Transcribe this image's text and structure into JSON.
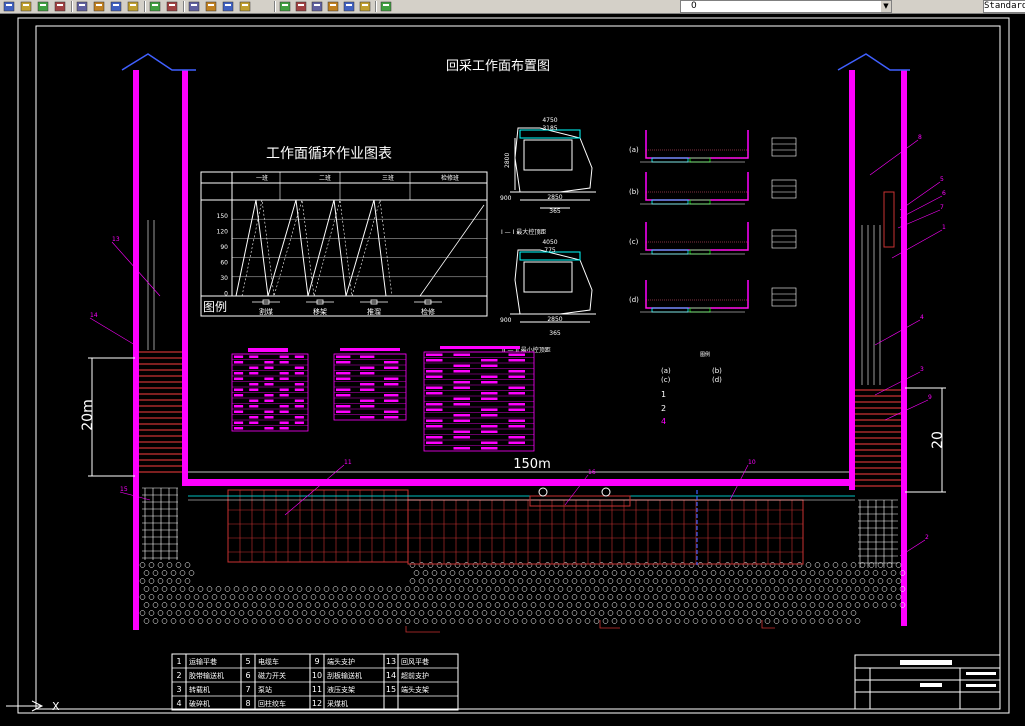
{
  "app": {
    "text_style_value": "Standard",
    "layer_value": "0"
  },
  "toolbar": {
    "icons": [
      "open-icon",
      "save-icon",
      "print-icon",
      "plot-preview-icon",
      "cut-icon",
      "copy-icon",
      "paste-icon",
      "match-properties-icon",
      "undo-icon",
      "redo-icon",
      "pan-icon",
      "zoom-realtime-icon",
      "zoom-window-icon",
      "zoom-previous-icon",
      "properties-icon",
      "design-center-icon",
      "tool-palettes-icon",
      "sheet-set-icon",
      "markup-icon",
      "calculator-icon",
      "help-icon"
    ]
  },
  "drawing": {
    "main_title": "回采工作面布置图",
    "cycle_chart_title": "工作面循环作业图表",
    "legend_title": "图例",
    "legend_items": [
      "割煤",
      "移架",
      "推溜",
      "检修"
    ],
    "chart_shift_headers": [
      "一班",
      "二班",
      "三班",
      "检修班"
    ],
    "chart_y_ticks": [
      "150",
      "120",
      "90",
      "60",
      "30",
      "0"
    ],
    "section_1_label": "I — I 最大控顶距",
    "section_2_label": "II — II 最小控顶距",
    "dim_top_1": "4750",
    "dim_top_2": "3185",
    "dim_mid_1": "2850",
    "dim_mid_2": "365",
    "dim_900": "900",
    "dim_2800": "2800",
    "dim_4050": "4050",
    "dim_775": "775",
    "dim_b_2850": "2850",
    "dim_b_365": "365",
    "dim_b_900": "900",
    "panel_labels": [
      "(a)",
      "(b)",
      "(c)",
      "(d)"
    ],
    "small_legend": [
      "(a)",
      "(b)",
      "(c)",
      "(d)",
      "1",
      "2",
      "4"
    ],
    "length_label": "150m",
    "left_dim": "20m",
    "right_dim": "20",
    "callouts": [
      "13",
      "14",
      "15",
      "11",
      "10",
      "16",
      "8",
      "5",
      "6",
      "7",
      "1",
      "4",
      "3",
      "9",
      "2"
    ]
  },
  "parts_table": {
    "rows": [
      [
        {
          "no": "1",
          "name": "运输平巷"
        },
        {
          "no": "5",
          "name": "电缆车"
        },
        {
          "no": "9",
          "name": "端头支护"
        },
        {
          "no": "13",
          "name": "回风平巷"
        }
      ],
      [
        {
          "no": "2",
          "name": "胶带输送机"
        },
        {
          "no": "6",
          "name": "磁力开关"
        },
        {
          "no": "10",
          "name": "刮板输送机"
        },
        {
          "no": "14",
          "name": "超前支护"
        }
      ],
      [
        {
          "no": "3",
          "name": "转载机"
        },
        {
          "no": "7",
          "name": "泵站"
        },
        {
          "no": "11",
          "name": "液压支架"
        },
        {
          "no": "15",
          "name": "端头支架"
        }
      ],
      [
        {
          "no": "4",
          "name": "破碎机"
        },
        {
          "no": "8",
          "name": "回柱绞车"
        },
        {
          "no": "12",
          "name": "采煤机"
        },
        {
          "no": "",
          "name": ""
        }
      ]
    ]
  },
  "colors": {
    "magenta": "#ff00ff",
    "red": "#c83232",
    "white": "#ffffff",
    "yellow": "#ffff00",
    "cyan": "#00ffff",
    "blue": "#4060ff",
    "green": "#00ff00"
  }
}
